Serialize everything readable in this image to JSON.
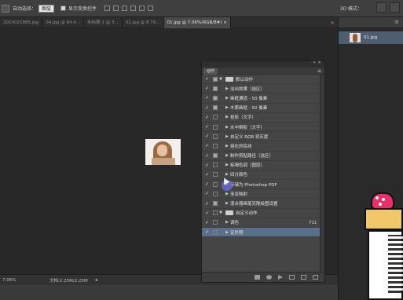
{
  "options_bar": {
    "auto_select_label": "自动选择：",
    "auto_select_value": "图层",
    "show_transform_label": "显示变换控件",
    "mode_3d_label": "3D 模式："
  },
  "tabs": [
    {
      "label": "2015021885.jpg",
      "active": false
    },
    {
      "label": "04.jpg @ 84.4...",
      "active": false
    },
    {
      "label": "未标题-1 @ 3...",
      "active": false
    },
    {
      "label": "02.jpg @ 8.79...",
      "active": false
    },
    {
      "label": "01.jpg @ 7.06%(RGB/8#) ×",
      "active": true
    }
  ],
  "tab_overflow": "»",
  "status_bar": {
    "zoom": "7.06%",
    "doc_info": "文档:2.25M/2.25M",
    "arrow": "▸"
  },
  "right_panel": {
    "menu": "≡",
    "items": [
      {
        "label": "01.jpg"
      }
    ]
  },
  "actions_panel": {
    "tab_label": "动作",
    "menu": "≡",
    "titlebar_controls": "«  ×",
    "rows": [
      {
        "check": "✓",
        "box": true,
        "tri": "▼",
        "folder": true,
        "indent": 0,
        "label": "默认动作",
        "selected": false,
        "shortcut": ""
      },
      {
        "check": "✓",
        "box": true,
        "tri": "▶",
        "folder": false,
        "indent": 1,
        "label": "淡出效果（选区）",
        "selected": false,
        "shortcut": ""
      },
      {
        "check": "✓",
        "box": true,
        "tri": "▶",
        "folder": false,
        "indent": 1,
        "label": "画框通道 - 50 像素",
        "selected": false,
        "shortcut": ""
      },
      {
        "check": "✓",
        "box": true,
        "tri": "▶",
        "folder": false,
        "indent": 1,
        "label": "木质画框 - 50 像素",
        "selected": false,
        "shortcut": ""
      },
      {
        "check": "✓",
        "box": false,
        "tri": "▶",
        "folder": false,
        "indent": 1,
        "label": "投影（文字）",
        "selected": false,
        "shortcut": ""
      },
      {
        "check": "✓",
        "box": false,
        "tri": "▶",
        "folder": false,
        "indent": 1,
        "label": "水中倒影（文字）",
        "selected": false,
        "shortcut": ""
      },
      {
        "check": "✓",
        "box": false,
        "tri": "▶",
        "folder": false,
        "indent": 1,
        "label": "自定义 RGB 到灰度",
        "selected": false,
        "shortcut": ""
      },
      {
        "check": "✓",
        "box": false,
        "tri": "▶",
        "folder": false,
        "indent": 1,
        "label": "熔化的铅块",
        "selected": false,
        "shortcut": ""
      },
      {
        "check": "✓",
        "box": true,
        "tri": "▶",
        "folder": false,
        "indent": 1,
        "label": "制作剪贴路径（选区）",
        "selected": false,
        "shortcut": ""
      },
      {
        "check": "✓",
        "box": false,
        "tri": "▶",
        "folder": false,
        "indent": 1,
        "label": "棕褐色调（图层）",
        "selected": false,
        "shortcut": ""
      },
      {
        "check": "✓",
        "box": false,
        "tri": "▶",
        "folder": false,
        "indent": 1,
        "label": "四分颜色",
        "selected": false,
        "shortcut": ""
      },
      {
        "check": "✓",
        "box": false,
        "tri": "▶",
        "folder": false,
        "indent": 1,
        "label": "存储为 Photoshop PDF",
        "selected": false,
        "shortcut": ""
      },
      {
        "check": "✓",
        "box": false,
        "tri": "▶",
        "folder": false,
        "indent": 1,
        "label": "渐变映射",
        "selected": false,
        "shortcut": ""
      },
      {
        "check": "✓",
        "box": true,
        "tri": "▶",
        "folder": false,
        "indent": 1,
        "label": "混合器画笔克隆绘图设置",
        "selected": false,
        "shortcut": ""
      },
      {
        "check": "✓",
        "box": false,
        "tri": "▼",
        "folder": true,
        "indent": 0,
        "label": "自定义动作",
        "selected": false,
        "shortcut": ""
      },
      {
        "check": "✓",
        "box": false,
        "tri": "▶",
        "folder": false,
        "indent": 1,
        "label": "调色",
        "selected": false,
        "shortcut": "F11"
      },
      {
        "check": "✓",
        "box": false,
        "tri": "▶",
        "folder": false,
        "indent": 1,
        "label": "证件照",
        "selected": true,
        "shortcut": ""
      }
    ]
  }
}
